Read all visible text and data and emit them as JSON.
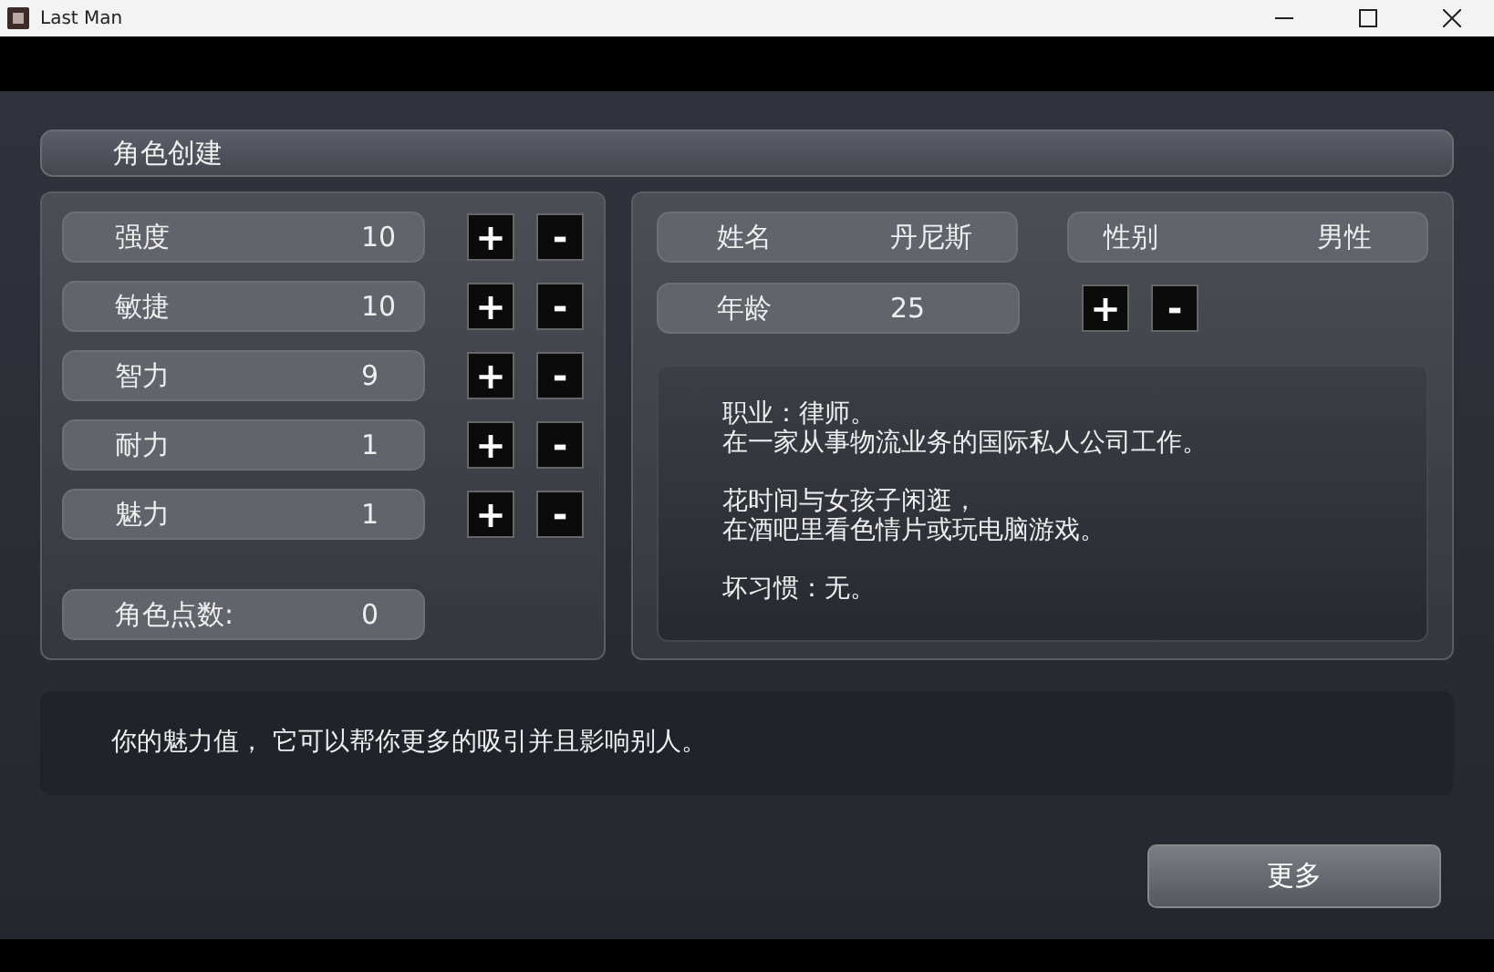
{
  "window": {
    "title": "Last Man"
  },
  "header": {
    "title": "角色创建"
  },
  "stats": [
    {
      "label": "强度",
      "value": "10",
      "plus": "+",
      "minus": "-"
    },
    {
      "label": "敏捷",
      "value": "10",
      "plus": "+",
      "minus": "-"
    },
    {
      "label": "智力",
      "value": "9",
      "plus": "+",
      "minus": "-"
    },
    {
      "label": "耐力",
      "value": "1",
      "plus": "+",
      "minus": "-"
    },
    {
      "label": "魅力",
      "value": "1",
      "plus": "+",
      "minus": "-"
    }
  ],
  "points": {
    "label": "角色点数:",
    "value": "0"
  },
  "identity": {
    "name": {
      "label": "姓名",
      "value": "丹尼斯"
    },
    "gender": {
      "label": "性别",
      "value": "男性"
    },
    "age": {
      "label": "年龄",
      "value": "25",
      "plus": "+",
      "minus": "-"
    }
  },
  "bio": [
    [
      "职业：律师。",
      "在一家从事物流业务的国际私人公司工作。"
    ],
    [
      "花时间与女孩子闲逛，",
      "在酒吧里看色情片或玩电脑游戏。"
    ],
    [
      "坏习惯：无。"
    ]
  ],
  "hint": "你的魅力值， 它可以帮你更多的吸引并且影响别人。",
  "more_button": "更多"
}
